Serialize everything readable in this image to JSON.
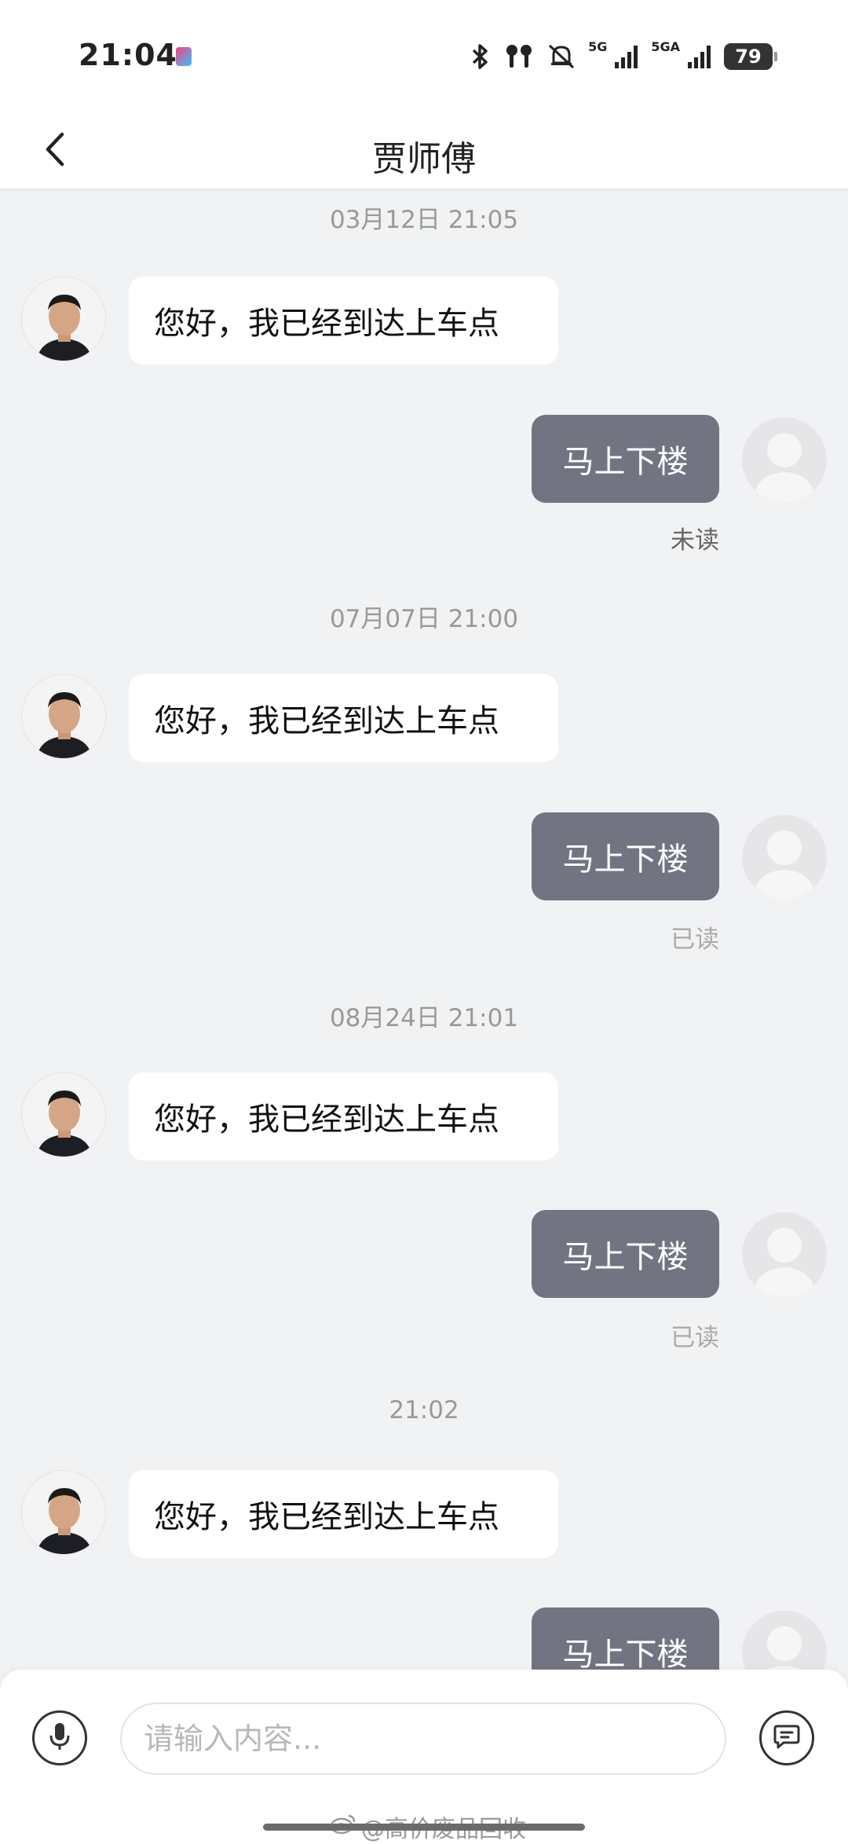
{
  "status_bar": {
    "time": "21:04",
    "network_1": "5G",
    "network_2": "5GA",
    "battery": "79"
  },
  "header": {
    "title": "贾师傅"
  },
  "messages": [
    {
      "timestamp": "03月12日 21:05",
      "incoming": "您好，我已经到达上车点",
      "outgoing": "马上下楼",
      "read_status": "未读"
    },
    {
      "timestamp": "07月07日 21:00",
      "incoming": "您好，我已经到达上车点",
      "outgoing": "马上下楼",
      "read_status": "已读"
    },
    {
      "timestamp": "08月24日 21:01",
      "incoming": "您好，我已经到达上车点",
      "outgoing": "马上下楼",
      "read_status": "已读"
    },
    {
      "timestamp": "21:02",
      "incoming": "您好，我已经到达上车点",
      "outgoing": "马上下楼"
    }
  ],
  "input": {
    "placeholder": "请输入内容..."
  },
  "watermark": "@高价废品回收",
  "colors": {
    "background": "#f1f2f4",
    "outgoing_bubble": "#727482",
    "incoming_bubble": "#ffffff"
  },
  "icons": {
    "back": "chevron-left-icon",
    "mic": "microphone-icon",
    "send": "chat-bubble-icon"
  }
}
